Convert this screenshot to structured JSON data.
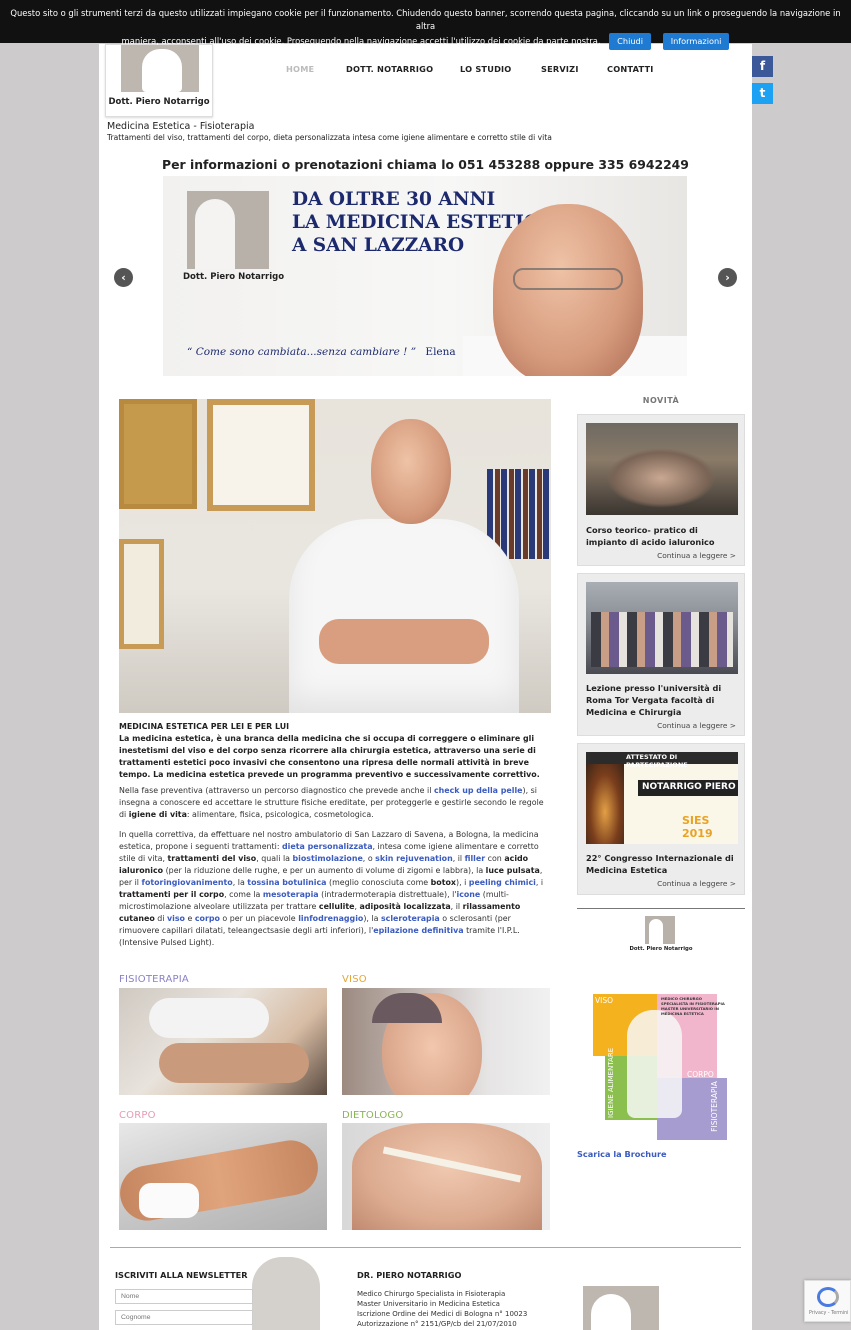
{
  "cookie_bar": {
    "text_line1": "Questo sito o gli strumenti terzi da questo utilizzati impiegano cookie per il funzionamento. Chiudendo questo banner, scorrendo questa pagina, cliccando su un link o proseguendo la navigazione in altra",
    "text_line2": "maniera, acconsenti all'uso dei cookie. Proseguendo nella navigazione accetti l'utilizzo dei cookie da parte nostra.",
    "close_label": "Chiudi",
    "info_label": "Informazioni",
    "accent": "#1f7ad1"
  },
  "header": {
    "logo_name": "Dott. Piero Notarrigo",
    "nav": [
      "HOME",
      "DOTT. NOTARRIGO",
      "LO STUDIO",
      "SERVIZI",
      "CONTATTI"
    ],
    "active_nav": "HOME",
    "social": [
      {
        "icon": "facebook-icon",
        "glyph": "f",
        "color": "#3b5998"
      },
      {
        "icon": "twitter-icon",
        "glyph": "t",
        "color": "#1da1f2"
      }
    ],
    "tagline_title": "Medicina Estetica - Fisioterapia",
    "tagline_sub": "Trattamenti del viso, trattamenti del corpo, dieta personalizzata intesa come igiene alimentare e corretto stile di vita"
  },
  "contact_strip": {
    "text": "Per informazioni o prenotazioni chiama lo  051 453288  oppure  335 6942249"
  },
  "hero": {
    "logo_name": "Dott. Piero Notarrigo",
    "title_line1": "DA OLTRE 30 ANNI",
    "title_line2": "LA MEDICINA ESTETICA",
    "title_line3": "A SAN LAZZARO",
    "quote": "“ Come sono cambiata...senza cambiare ! ”",
    "quote_author": "Elena",
    "prev_glyph": "‹",
    "next_glyph": "›"
  },
  "intro": {
    "heading": "MEDICINA ESTETICA PER LEI E PER LUI",
    "bold_paragraph": "La medicina estetica, è una branca della medicina che si occupa di correggere o eliminare gli inestetismi del viso e del corpo senza ricorrere alla chirurgia estetica, attraverso una serie di trattamenti estetici poco invasivi che consentono una ripresa delle normali attività in breve tempo. La medicina estetica prevede un programma preventivo e successivamente correttivo.",
    "p2_a": "Nella fase preventiva (attraverso un percorso diagnostico che prevede anche il ",
    "p2_link": "check up della pelle",
    "p2_b": "), si insegna a conoscere ed accettare le strutture fisiche ereditate, per proteggerle e gestirle secondo le regole di ",
    "p2_bold": "igiene di vita",
    "p2_c": ": alimentare, fisica, psicologica, cosmetologica.",
    "p3": [
      {
        "t": "In quella correttiva, da effettuare nel nostro ambulatorio di San Lazzaro di Savena, a Bologna, la medicina estetica, propone i seguenti trattamenti: ",
        "k": "n"
      },
      {
        "t": "dieta personalizzata",
        "k": "l"
      },
      {
        "t": ", intesa come igiene alimentare e corretto stile di vita, ",
        "k": "n"
      },
      {
        "t": "trattamenti del viso",
        "k": "b"
      },
      {
        "t": ", quali la ",
        "k": "n"
      },
      {
        "t": "biostimolazione",
        "k": "l"
      },
      {
        "t": ", o ",
        "k": "n"
      },
      {
        "t": "skin rejuvenation",
        "k": "l"
      },
      {
        "t": ", il ",
        "k": "n"
      },
      {
        "t": "filler",
        "k": "l"
      },
      {
        "t": " con ",
        "k": "n"
      },
      {
        "t": "acido ialuronico",
        "k": "b"
      },
      {
        "t": " (per la riduzione delle rughe, e per un aumento di volume di zigomi e labbra), la ",
        "k": "n"
      },
      {
        "t": "luce pulsata",
        "k": "b"
      },
      {
        "t": ", per il ",
        "k": "n"
      },
      {
        "t": "fotoringiovanimento",
        "k": "l"
      },
      {
        "t": ", la ",
        "k": "n"
      },
      {
        "t": "tossina botulinica",
        "k": "l"
      },
      {
        "t": " (meglio conosciuta come ",
        "k": "n"
      },
      {
        "t": "botox",
        "k": "b"
      },
      {
        "t": "), i ",
        "k": "n"
      },
      {
        "t": "peeling chimici",
        "k": "l"
      },
      {
        "t": ", i ",
        "k": "n"
      },
      {
        "t": "trattamenti per il corpo",
        "k": "b"
      },
      {
        "t": ", come la ",
        "k": "n"
      },
      {
        "t": "mesoterapia",
        "k": "l"
      },
      {
        "t": " (intradermoterapia distrettuale), l'",
        "k": "n"
      },
      {
        "t": "icone",
        "k": "l"
      },
      {
        "t": " (multi-microstimolazione alveolare utilizzata per trattare ",
        "k": "n"
      },
      {
        "t": "cellulite",
        "k": "b"
      },
      {
        "t": ", ",
        "k": "n"
      },
      {
        "t": "adiposità localizzata",
        "k": "b"
      },
      {
        "t": ", il ",
        "k": "n"
      },
      {
        "t": "rilassamento cutaneo",
        "k": "b"
      },
      {
        "t": " di ",
        "k": "n"
      },
      {
        "t": "viso",
        "k": "l"
      },
      {
        "t": " e ",
        "k": "n"
      },
      {
        "t": "corpo",
        "k": "l"
      },
      {
        "t": " o per un piacevole ",
        "k": "n"
      },
      {
        "t": "linfodrenaggio",
        "k": "l"
      },
      {
        "t": "), la ",
        "k": "n"
      },
      {
        "t": "scleroterapia",
        "k": "l"
      },
      {
        "t": " o sclerosanti (per rimuovere capillari dilatati, teleangectsasie degli arti inferiori), l'",
        "k": "n"
      },
      {
        "t": "epilazione definitiva",
        "k": "l"
      },
      {
        "t": " tramite l'I.P.L. (Intensive Pulsed Light).",
        "k": "n"
      }
    ]
  },
  "categories": [
    {
      "label": "FISIOTERAPIA",
      "color": "#8a82c4"
    },
    {
      "label": "VISO",
      "color": "#e6a533"
    },
    {
      "label": "CORPO",
      "color": "#e79ab3"
    },
    {
      "label": "DIETOLOGO",
      "color": "#8bb454"
    }
  ],
  "sidebar": {
    "title": "NOVITÀ",
    "cards": [
      {
        "title": "Corso teorico- pratico di impianto di acido ialuronico",
        "more": "Continua a leggere >"
      },
      {
        "title": "Lezione presso l'università di Roma Tor Vergata facoltà di Medicina e Chirurgia",
        "more": "Continua a leggere >"
      },
      {
        "title": "22° Congresso Internazionale di Medicina Estetica",
        "more": "Continua a leggere >",
        "cert_title": "ATTESTATO DI PARTECIPAZIONE",
        "cert_name": "NOTARRIGO PIERO",
        "cert_event": "SIES 2019"
      }
    ],
    "logo_name": "Dott. Piero Notarrigo",
    "brochure": {
      "viso": "VISO",
      "corpo": "CORPO",
      "igiene": "IGIENE ALIMENTARE",
      "fisio": "FISIOTERAPIA",
      "header_text": "MEDICO CHIRURGO SPECIALISTA IN FISIOTERAPIA MASTER UNIVERSITARIO IN MEDICINA ESTETICA"
    },
    "brochure_link": "Scarica la Brochure"
  },
  "footer": {
    "newsletter_title": "ISCRIVITI ALLA NEWSLETTER",
    "name_placeholder": "Nome",
    "surname_placeholder": "Cognome",
    "doctor_title": "DR. PIERO NOTARRIGO",
    "lines": [
      "Medico Chirurgo Specialista in Fisioterapia",
      "Master Universitario in Medicina Estetica",
      "Iscrizione Ordine dei Medici di Bologna n° 10023",
      "Autorizzazione n° 2151/GP/cb del 21/07/2010"
    ]
  },
  "recaptcha": {
    "text": "Privacy - Termini"
  }
}
